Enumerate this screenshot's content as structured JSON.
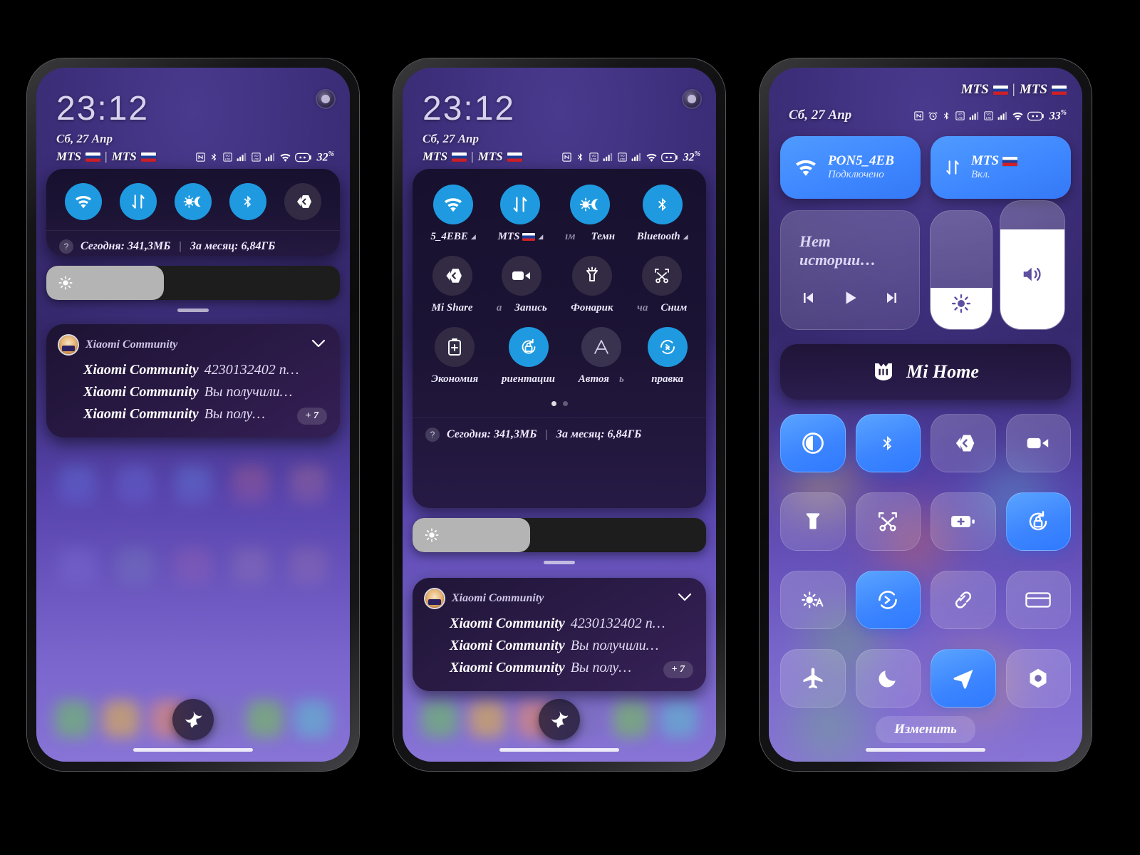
{
  "status": {
    "time": "23:12",
    "date": "Сб, 27 Апр",
    "carrier1": "MTS",
    "carrier2": "MTS",
    "battery_p1": "32",
    "battery_p2": "32",
    "battery_p3": "33",
    "percent_sign": "%"
  },
  "phone1": {
    "toggles": [
      {
        "name": "wifi",
        "label": "",
        "on": true
      },
      {
        "name": "mobile-data",
        "label": "",
        "on": true
      },
      {
        "name": "dark-mode",
        "label": "",
        "on": true
      },
      {
        "name": "bluetooth",
        "label": "",
        "on": true
      },
      {
        "name": "mi-share",
        "label": "",
        "on": false
      }
    ],
    "data_today_label": "Сегодня: 341,3МБ",
    "data_month_label": "За месяц: 6,84ГБ",
    "separator": "|",
    "help_glyph": "?",
    "brightness_percent": 40
  },
  "phone2": {
    "row1": [
      {
        "name": "wifi",
        "label": "5_4EBE",
        "on": true,
        "caret": "◢"
      },
      {
        "name": "mobile-data",
        "label": "MTS",
        "on": true,
        "flag": true,
        "caret": "◢"
      },
      {
        "name": "dark-mode",
        "label": "Темн",
        "on": true,
        "ghost": "ıм"
      },
      {
        "name": "bluetooth",
        "label": "Bluetooth",
        "on": true,
        "caret": "◢"
      }
    ],
    "row2": [
      {
        "name": "mi-share",
        "label": "Mi Share",
        "on": false
      },
      {
        "name": "screen-record",
        "label": "Запись",
        "on": false,
        "ghost": "а"
      },
      {
        "name": "flashlight",
        "label": "Фонарик",
        "on": false
      },
      {
        "name": "screenshot",
        "label": "Сним",
        "on": false,
        "ghost": "ча"
      }
    ],
    "row3": [
      {
        "name": "battery-saver",
        "label": "Экономия",
        "on": false
      },
      {
        "name": "auto-rotate",
        "label": "риентации",
        "on": true
      },
      {
        "name": "font-size",
        "label": "Автоя",
        "on": false,
        "ghost": "ь"
      },
      {
        "name": "sync",
        "label": "правка",
        "on": true
      }
    ],
    "page_dots": [
      true,
      false
    ],
    "data_today_label": "Сегодня: 341,3МБ",
    "data_month_label": "За месяц: 6,84ГБ",
    "separator": "|",
    "help_glyph": "?",
    "brightness_percent": 40
  },
  "notification": {
    "app": "Xiaomi Community",
    "lines": [
      {
        "bold": "Xiaomi Community",
        "rest": "4230132402 n…"
      },
      {
        "bold": "Xiaomi Community",
        "rest": "Вы получили…"
      },
      {
        "bold": "Xiaomi Community",
        "rest": "Вы полу…"
      }
    ],
    "more_badge": "+ 7",
    "expand_icon": "chevron-down-icon"
  },
  "phone3": {
    "wifi_tile": {
      "title": "PON5_4EB",
      "subtitle": "Подключено",
      "icon": "wifi-icon",
      "on": true
    },
    "data_tile": {
      "title": "MTS",
      "subtitle": "Вкл.",
      "icon": "mobile-data-icon",
      "on": true,
      "flag": true
    },
    "media": {
      "title": "Нет истории…",
      "prev": "skip-previous-icon",
      "play": "play-icon",
      "next": "skip-next-icon"
    },
    "brightness_slider": {
      "name": "brightness-slider",
      "percent": 35,
      "icon": "brightness-icon"
    },
    "volume_slider": {
      "name": "volume-slider",
      "percent": 78,
      "icon": "volume-icon"
    },
    "mi_home": {
      "label": "Mi Home",
      "icon": "mi-home-icon"
    },
    "grid": [
      {
        "name": "dark-mode",
        "icon": "contrast-icon",
        "on": true
      },
      {
        "name": "bluetooth",
        "icon": "bluetooth-icon",
        "on": true
      },
      {
        "name": "mi-share",
        "icon": "mi-share-icon",
        "on": false
      },
      {
        "name": "screen-record",
        "icon": "video-camera-icon",
        "on": false
      },
      {
        "name": "flashlight",
        "icon": "flashlight-icon",
        "on": false
      },
      {
        "name": "screenshot",
        "icon": "scissors-icon",
        "on": false
      },
      {
        "name": "battery-saver",
        "icon": "battery-plus-icon",
        "on": false
      },
      {
        "name": "auto-rotate-lock",
        "icon": "rotate-lock-icon",
        "on": true
      },
      {
        "name": "auto-brightness",
        "icon": "auto-brightness-icon",
        "on": false
      },
      {
        "name": "sync",
        "icon": "sync-icon",
        "on": true
      },
      {
        "name": "cast-link",
        "icon": "link-icon",
        "on": false
      },
      {
        "name": "wallet",
        "icon": "card-icon",
        "on": false
      },
      {
        "name": "airplane-mode",
        "icon": "airplane-icon",
        "on": false
      },
      {
        "name": "do-not-disturb",
        "icon": "moon-icon",
        "on": false
      },
      {
        "name": "location",
        "icon": "navigation-icon",
        "on": true
      },
      {
        "name": "camera-settings",
        "icon": "aperture-icon",
        "on": false
      }
    ],
    "edit_label": "Изменить"
  }
}
